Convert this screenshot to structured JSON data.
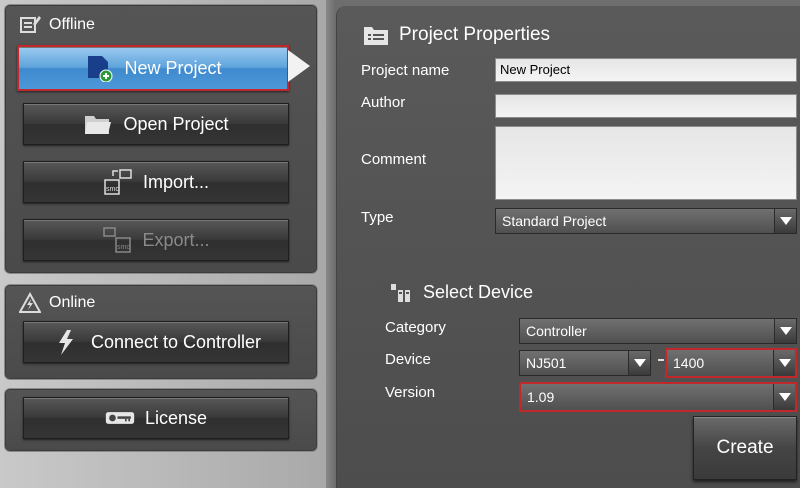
{
  "sidebar": {
    "offline": {
      "header": "Offline",
      "new_project": "New Project",
      "open_project": "Open Project",
      "import": "Import...",
      "export": "Export..."
    },
    "online": {
      "header": "Online",
      "connect": "Connect to Controller"
    },
    "license": "License"
  },
  "project_properties": {
    "title": "Project Properties",
    "project_name_label": "Project name",
    "project_name_value": "New Project",
    "author_label": "Author",
    "author_value": "",
    "comment_label": "Comment",
    "comment_value": "",
    "type_label": "Type",
    "type_value": "Standard Project"
  },
  "select_device": {
    "title": "Select Device",
    "category_label": "Category",
    "category_value": "Controller",
    "device_label": "Device",
    "device_value": "NJ501",
    "device_model_value": "1400",
    "version_label": "Version",
    "version_value": "1.09"
  },
  "create_label": "Create",
  "colors": {
    "highlight_border": "#c0282c",
    "primary_button": "#4c98d8"
  }
}
